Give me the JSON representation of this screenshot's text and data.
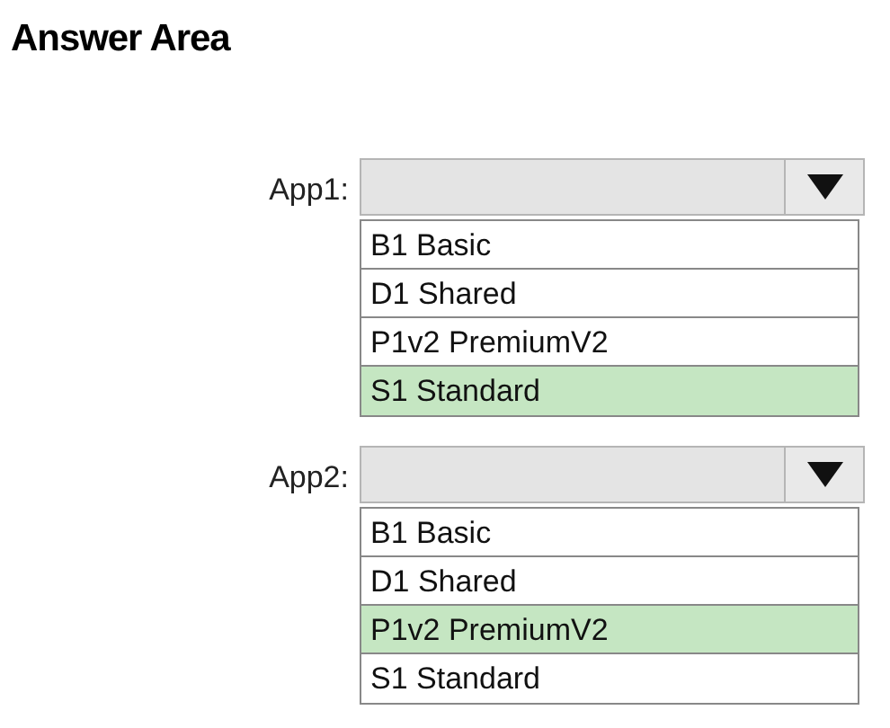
{
  "title": "Answer Area",
  "questions": [
    {
      "label": "App1:",
      "options": [
        {
          "text": "B1 Basic",
          "selected": false
        },
        {
          "text": "D1 Shared",
          "selected": false
        },
        {
          "text": "P1v2 PremiumV2",
          "selected": false
        },
        {
          "text": "S1 Standard",
          "selected": true
        }
      ]
    },
    {
      "label": "App2:",
      "options": [
        {
          "text": "B1 Basic",
          "selected": false
        },
        {
          "text": "D1 Shared",
          "selected": false
        },
        {
          "text": "P1v2 PremiumV2",
          "selected": true
        },
        {
          "text": "S1 Standard",
          "selected": false
        }
      ]
    }
  ]
}
